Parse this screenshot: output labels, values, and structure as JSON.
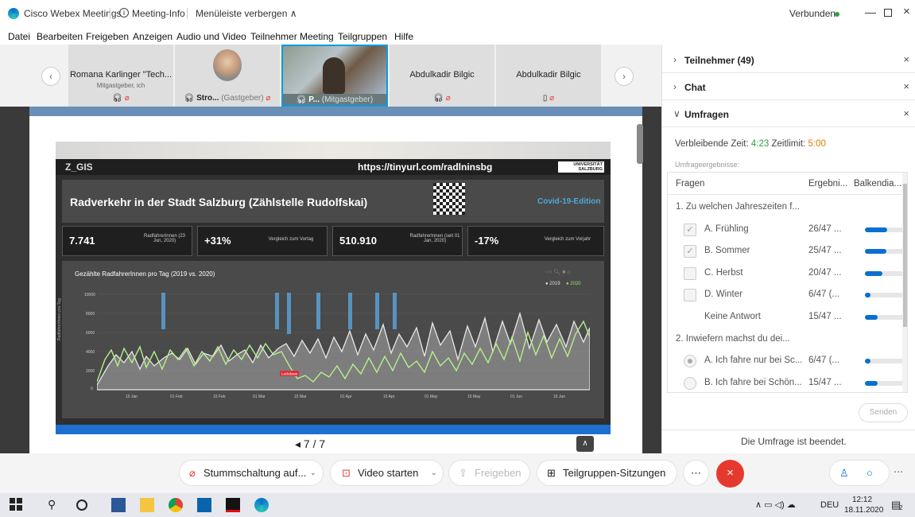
{
  "titlebar": {
    "app": "Cisco Webex Meetings",
    "info": "Meeting-Info",
    "hide_menu": "Menüleiste verbergen ∧",
    "status": "Verbunden"
  },
  "menu": [
    "Datei",
    "Bearbeiten",
    "Freigeben",
    "Anzeigen",
    "Audio und Video",
    "Teilnehmer",
    "Meeting",
    "Teilgruppen",
    "Hilfe"
  ],
  "participants": [
    {
      "name": "Romana Karlinger \"Tech...",
      "sub": "Mitgastgeber, ich"
    },
    {
      "name": "Stro...",
      "role": "(Gastgeber)"
    },
    {
      "name": "P...",
      "role": "(Mitgastgeber)"
    },
    {
      "name": "Abdulkadir Bilgic"
    },
    {
      "name": "Abdulkadir Bilgic"
    }
  ],
  "slide": {
    "brand": "Z_GIS",
    "url": "https://tinyurl.com/radlninsbg",
    "uni": "UNIVERSITÄT SALZBURG",
    "title": "Radverkehr in der Stadt Salzburg (Zählstelle Rudolfskai)",
    "edition": "Covid-19-Edition",
    "kpis": [
      {
        "value": "7.741",
        "label": "RadfahrerInnen (23 Jun, 2020)"
      },
      {
        "value": "+31%",
        "label": "Vergleich zum Vortag"
      },
      {
        "value": "510.910",
        "label": "RadfahrerInnen (seit 01 Jan, 2020)"
      },
      {
        "value": "-17%",
        "label": "Vergleich zum Vorjahr"
      }
    ],
    "chart_title": "Gezählte RadfahrerInnen pro Tag (2019 vs. 2020)",
    "legend": [
      "● 2019",
      "● 2020"
    ],
    "ylabel": "RadfahrerInnen pro Tag",
    "yticks": [
      "10000",
      "8000",
      "6000",
      "4000",
      "2000",
      "0"
    ],
    "xticks": [
      "15 Jan",
      "01 Feb",
      "15 Feb",
      "01 Mar",
      "15 Mar",
      "01 Apr",
      "15 Apr",
      "01 May",
      "15 May",
      "01 Jun",
      "15 Jun"
    ],
    "annotation": "Lockdown",
    "page": "◂ 7 / 7"
  },
  "panel": {
    "participants_hdr": "Teilnehmer (49)",
    "chat_hdr": "Chat",
    "polls_hdr": "Umfragen",
    "time_label": "Verbleibende Zeit:",
    "time_value": "4:23",
    "limit_label": "Zeitlimit:",
    "limit_value": "5:00",
    "results_label": "Umfrageergebnisse:",
    "col_questions": "Fragen",
    "col_results": "Ergebni...",
    "col_bars": "Balkendia...",
    "rows": [
      {
        "type": "q",
        "text": "1. Zu welchen Jahreszeiten f..."
      },
      {
        "type": "check",
        "checked": true,
        "text": "A.  Frühling",
        "result": "26/47 ...",
        "fill": 0.553
      },
      {
        "type": "check",
        "checked": true,
        "text": "B.  Sommer",
        "result": "25/47 ...",
        "fill": 0.532
      },
      {
        "type": "check",
        "checked": false,
        "text": "C.  Herbst",
        "result": "20/47 ...",
        "fill": 0.426
      },
      {
        "type": "check",
        "checked": false,
        "text": "D.  Winter",
        "result": "6/47 (...",
        "fill": 0.128
      },
      {
        "type": "none",
        "text": "Keine Antwort",
        "result": "15/47 ...",
        "fill": 0.319
      },
      {
        "type": "q",
        "text": "2. Inwiefern machst du dei..."
      },
      {
        "type": "radio",
        "checked": true,
        "text": "A.  Ich fahre nur bei Sc...",
        "result": "6/47 (...",
        "fill": 0.128
      },
      {
        "type": "radio",
        "checked": false,
        "text": "B.  Ich fahre bei Schön...",
        "result": "15/47 ...",
        "fill": 0.319
      }
    ],
    "send": "Senden",
    "ended": "Die Umfrage ist beendet."
  },
  "bottombar": {
    "mute": "Stummschaltung auf...",
    "video": "Video starten",
    "share": "Freigeben",
    "breakout": "Teilgruppen-Sitzungen"
  },
  "taskbar": {
    "lang": "DEU",
    "time": "12:12",
    "date": "18.11.2020",
    "notif": "2"
  },
  "colors": {
    "accent": "#0a6fd0",
    "green": "#2ea043",
    "orange": "#e07a00",
    "end_red": "#e5392e"
  }
}
